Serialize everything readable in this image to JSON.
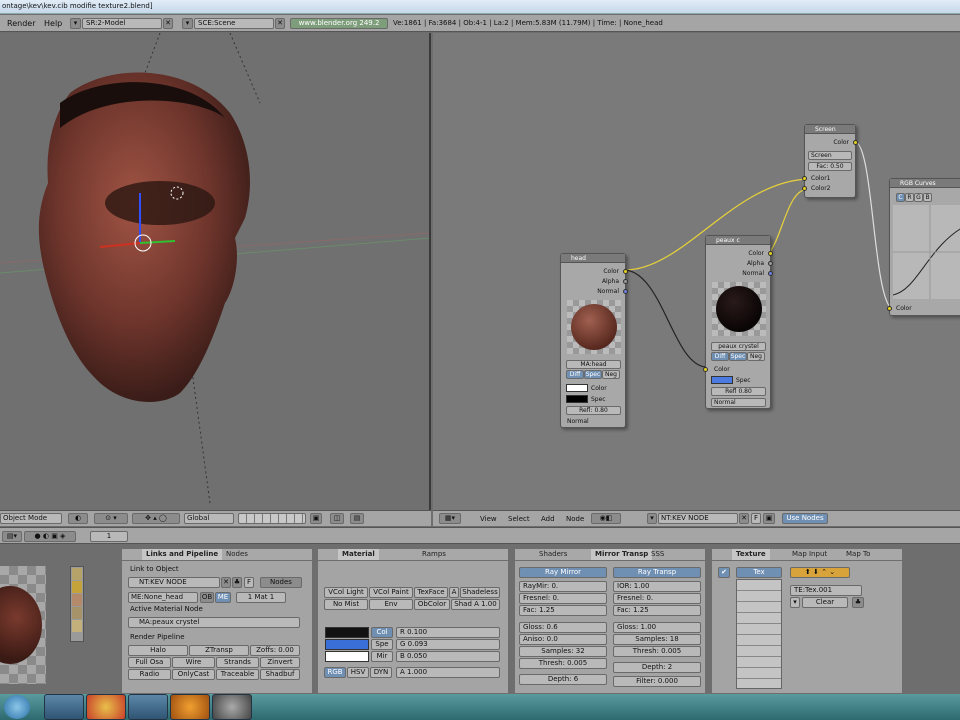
{
  "title_bar": {
    "path": "ontage\\kev\\kev.cib modifie texture2.blend]"
  },
  "menu": {
    "items": [
      "Render",
      "Help"
    ]
  },
  "header": {
    "screen": "SR:2-Model",
    "scene": "SCE:Scene",
    "url": "www.blender.org 249.2",
    "stats": "Ve:1861 | Fa:3684 | Ob:4-1 | La:2 | Mem:5.83M (11.79M) | Time: | None_head"
  },
  "viewport_header": {
    "mode": "Object Mode",
    "orientation": "Global"
  },
  "node_header": {
    "menus": [
      "View",
      "Select",
      "Add",
      "Node"
    ],
    "nodetree": "NT:KEV NODE",
    "use_nodes": "Use Nodes",
    "f_label": "F"
  },
  "nodes": {
    "head": {
      "title": "head",
      "outputs": [
        "Color",
        "Alpha",
        "Normal"
      ],
      "material": "MA:head",
      "toggles": [
        "Diff",
        "Spec",
        "Neg"
      ],
      "inputs": [
        "Color",
        "Spec"
      ],
      "refl": "Refl: 0.80",
      "normal": "Normal"
    },
    "peaux": {
      "title": "peaux c",
      "outputs": [
        "Color",
        "Alpha",
        "Normal"
      ],
      "material": "peaux crystel",
      "toggles": [
        "Diff",
        "Spec",
        "Neg"
      ],
      "inputs": [
        "Color",
        "Spec"
      ],
      "refl": "Refl 0.80",
      "normal": "Normal"
    },
    "screen": {
      "title": "Screen",
      "output": "Color",
      "mode": "Screen",
      "fac": "Fac: 0.50",
      "inputs": [
        "Color1",
        "Color2"
      ]
    },
    "rgbcurves": {
      "title": "RGB Curves",
      "channels": [
        "C",
        "R",
        "G",
        "B"
      ],
      "input": "Color"
    }
  },
  "bottom_header": {
    "frame": "1"
  },
  "links_panel": {
    "tabs": [
      "Links and Pipeline",
      "Nodes"
    ],
    "link_to_object": "Link to Object",
    "nodetree": "NT:KEV NODE",
    "nodes_btn": "Nodes",
    "mesh": "ME:None_head",
    "ob": "OB",
    "me": "ME",
    "mat": "1 Mat 1",
    "active_label": "Active Material Node",
    "active": "MA:peaux crystel",
    "pipeline_label": "Render Pipeline",
    "row1": [
      "Halo",
      "ZTransp",
      "Zoffs: 0.00"
    ],
    "row2": [
      "Full Osa",
      "Wire",
      "Strands",
      "Zinvert"
    ],
    "row3": [
      "Radio",
      "OnlyCast",
      "Traceable",
      "Shadbuf"
    ]
  },
  "material_panel": {
    "tabs": [
      "Material",
      "Ramps"
    ],
    "row1": [
      "VCol Light",
      "VCol Paint",
      "TexFace",
      "A",
      "Shadeless"
    ],
    "row2": [
      "No Mist",
      "Env",
      "ObColor",
      "Shad A 1.00"
    ],
    "col_labels": [
      "Col",
      "Spe",
      "Mir"
    ],
    "r": "R 0.100",
    "g": "G 0.093",
    "b": "B 0.050",
    "modes": [
      "RGB",
      "HSV",
      "DYN"
    ],
    "alpha": "A 1.000"
  },
  "shaders_panel": {
    "tabs": [
      "Shaders",
      "Mirror Transp",
      "SSS"
    ],
    "ray_mirror": "Ray Mirror",
    "ray_transp": "Ray Transp",
    "left": [
      "RayMir: 0.",
      "Fresnel: 0.",
      "Fac: 1.25",
      "Gloss: 0.6",
      "Aniso: 0.0",
      "Samples: 32",
      "Thresh: 0.005",
      "Depth: 6"
    ],
    "right": [
      "IOR: 1.00",
      "Fresnel: 0.",
      "Fac: 1.25",
      "Gloss: 1.00",
      "Samples: 18",
      "Thresh: 0.005",
      "Depth: 2",
      "Filter: 0.000"
    ]
  },
  "texture_panel": {
    "tabs": [
      "Texture",
      "Map Input",
      "Map To"
    ],
    "tex": "Tex",
    "texname": "TE:Tex.001",
    "clear": "Clear"
  },
  "colors": {
    "title": "#d7e4f2",
    "header": "#a5a5a5",
    "viewport": "#6e6e6e",
    "node_bg": "#7a7a7a",
    "panel": "#a4a4a4",
    "link": "#e8d23a"
  }
}
